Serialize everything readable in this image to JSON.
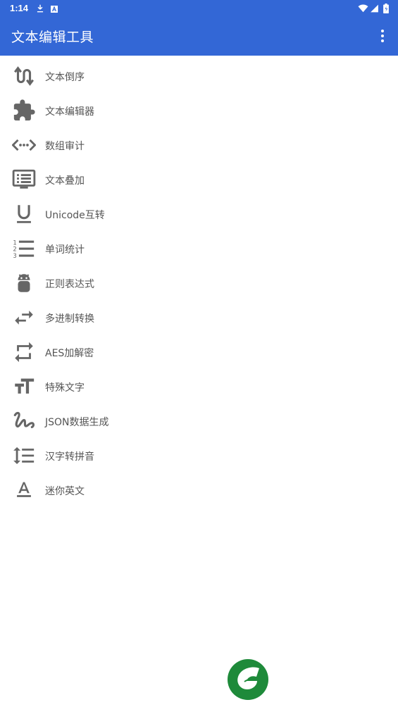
{
  "status_bar": {
    "time": "1:14"
  },
  "app_bar": {
    "title": "文本编辑工具"
  },
  "menu": [
    {
      "label": "文本倒序",
      "icon": "swap-vertical-icon"
    },
    {
      "label": "文本编辑器",
      "icon": "puzzle-icon"
    },
    {
      "label": "数组审计",
      "icon": "code-dots-icon"
    },
    {
      "label": "文本叠加",
      "icon": "monitor-list-icon"
    },
    {
      "label": "Unicode互转",
      "icon": "underline-icon"
    },
    {
      "label": "单词统计",
      "icon": "ordered-list-icon"
    },
    {
      "label": "正则表达式",
      "icon": "android-icon"
    },
    {
      "label": "多进制转换",
      "icon": "swap-horizontal-icon"
    },
    {
      "label": "AES加解密",
      "icon": "repeat-icon"
    },
    {
      "label": "特殊文字",
      "icon": "text-size-icon"
    },
    {
      "label": "JSON数据生成",
      "icon": "gesture-icon"
    },
    {
      "label": "汉字转拼音",
      "icon": "line-spacing-icon"
    },
    {
      "label": "迷你英文",
      "icon": "text-format-icon"
    }
  ],
  "colors": {
    "primary": "#3367d6",
    "icon": "#666666",
    "text": "#555555",
    "logo": "#1e8a3a"
  }
}
